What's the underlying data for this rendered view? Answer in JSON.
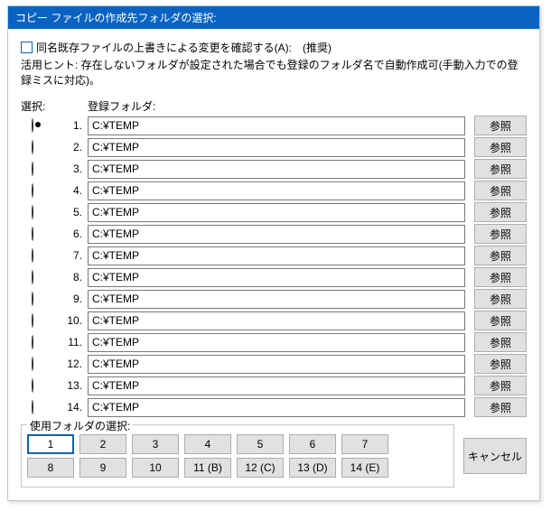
{
  "title": "コピー ファイルの作成先フォルダの選択:",
  "confirmOverwriteLabel": "同名既存ファイルの上書きによる変更を確認する(A):　(推奨)",
  "hint": "活用ヒント: 存在しないフォルダが設定された場合でも登録のフォルダ名で自動作成可(手動入力での登録ミスに対応)。",
  "headers": {
    "select": "選択:",
    "folder": "登録フォルダ:"
  },
  "browseLabel": "参照",
  "rows": [
    {
      "n": "1.",
      "path": "C:¥TEMP",
      "selected": true
    },
    {
      "n": "2.",
      "path": "C:¥TEMP",
      "selected": false
    },
    {
      "n": "3.",
      "path": "C:¥TEMP",
      "selected": false
    },
    {
      "n": "4.",
      "path": "C:¥TEMP",
      "selected": false
    },
    {
      "n": "5.",
      "path": "C:¥TEMP",
      "selected": false
    },
    {
      "n": "6.",
      "path": "C:¥TEMP",
      "selected": false
    },
    {
      "n": "7.",
      "path": "C:¥TEMP",
      "selected": false
    },
    {
      "n": "8.",
      "path": "C:¥TEMP",
      "selected": false
    },
    {
      "n": "9.",
      "path": "C:¥TEMP",
      "selected": false
    },
    {
      "n": "10.",
      "path": "C:¥TEMP",
      "selected": false
    },
    {
      "n": "11.",
      "path": "C:¥TEMP",
      "selected": false
    },
    {
      "n": "12.",
      "path": "C:¥TEMP",
      "selected": false
    },
    {
      "n": "13.",
      "path": "C:¥TEMP",
      "selected": false
    },
    {
      "n": "14.",
      "path": "C:¥TEMP",
      "selected": false
    }
  ],
  "footer": {
    "legend": "使用フォルダの選択:",
    "row1": [
      "1",
      "2",
      "3",
      "4",
      "5",
      "6",
      "7"
    ],
    "row2": [
      "8",
      "9",
      "10",
      "11 (B)",
      "12 (C)",
      "13 (D)",
      "14 (E)"
    ],
    "active": "1"
  },
  "cancelLabel": "キャンセル"
}
